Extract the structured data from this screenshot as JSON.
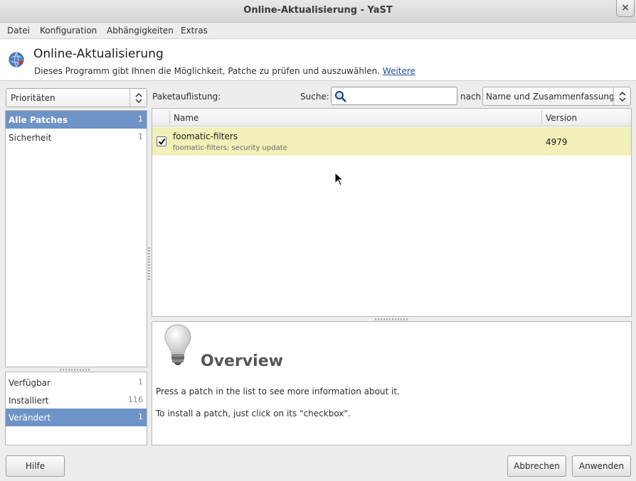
{
  "window": {
    "title": "Online-Aktualisierung - YaST",
    "close_label": "×"
  },
  "menu": {
    "items": [
      "Datei",
      "Konfiguration",
      "Abhängigkeiten",
      "Extras"
    ]
  },
  "header": {
    "title": "Online-Aktualisierung",
    "description": "Dieses Programm gibt Ihnen die Möglichkeit, Patche zu prüfen und auszuwählen.",
    "link": "Weitere",
    "icon": "globe-update-icon"
  },
  "filter": {
    "combo_value": "Prioritäten",
    "categories": [
      {
        "name": "Alle Patches",
        "count": "1"
      },
      {
        "name": "Sicherheit",
        "count": "1"
      }
    ],
    "states": [
      {
        "name": "Verfügbar",
        "count": "1"
      },
      {
        "name": "Installiert",
        "count": "116"
      },
      {
        "name": "Verändert",
        "count": "1"
      }
    ]
  },
  "search": {
    "list_label": "Paketauflistung:",
    "search_label": "Suche:",
    "value": "",
    "nach_label": "nach",
    "field_value": "Name und Zusammenfassung"
  },
  "table": {
    "columns": {
      "name": "Name",
      "version": "Version"
    },
    "rows": [
      {
        "name": "foomatic-filters",
        "summary": "foomatic-filters: security update",
        "version": "4979",
        "checked": true
      }
    ],
    "row_color": "#f0f0b8"
  },
  "overview": {
    "title": "Overview",
    "line1": "Press a patch in the list to see more information about it.",
    "line2": "To install a patch, just click on its \"checkbox\"."
  },
  "buttons": {
    "help": "Hilfe",
    "cancel": "Abbrechen",
    "apply": "Anwenden"
  },
  "colors": {
    "selection": "#6e93c7",
    "link": "#1a4f9c"
  }
}
